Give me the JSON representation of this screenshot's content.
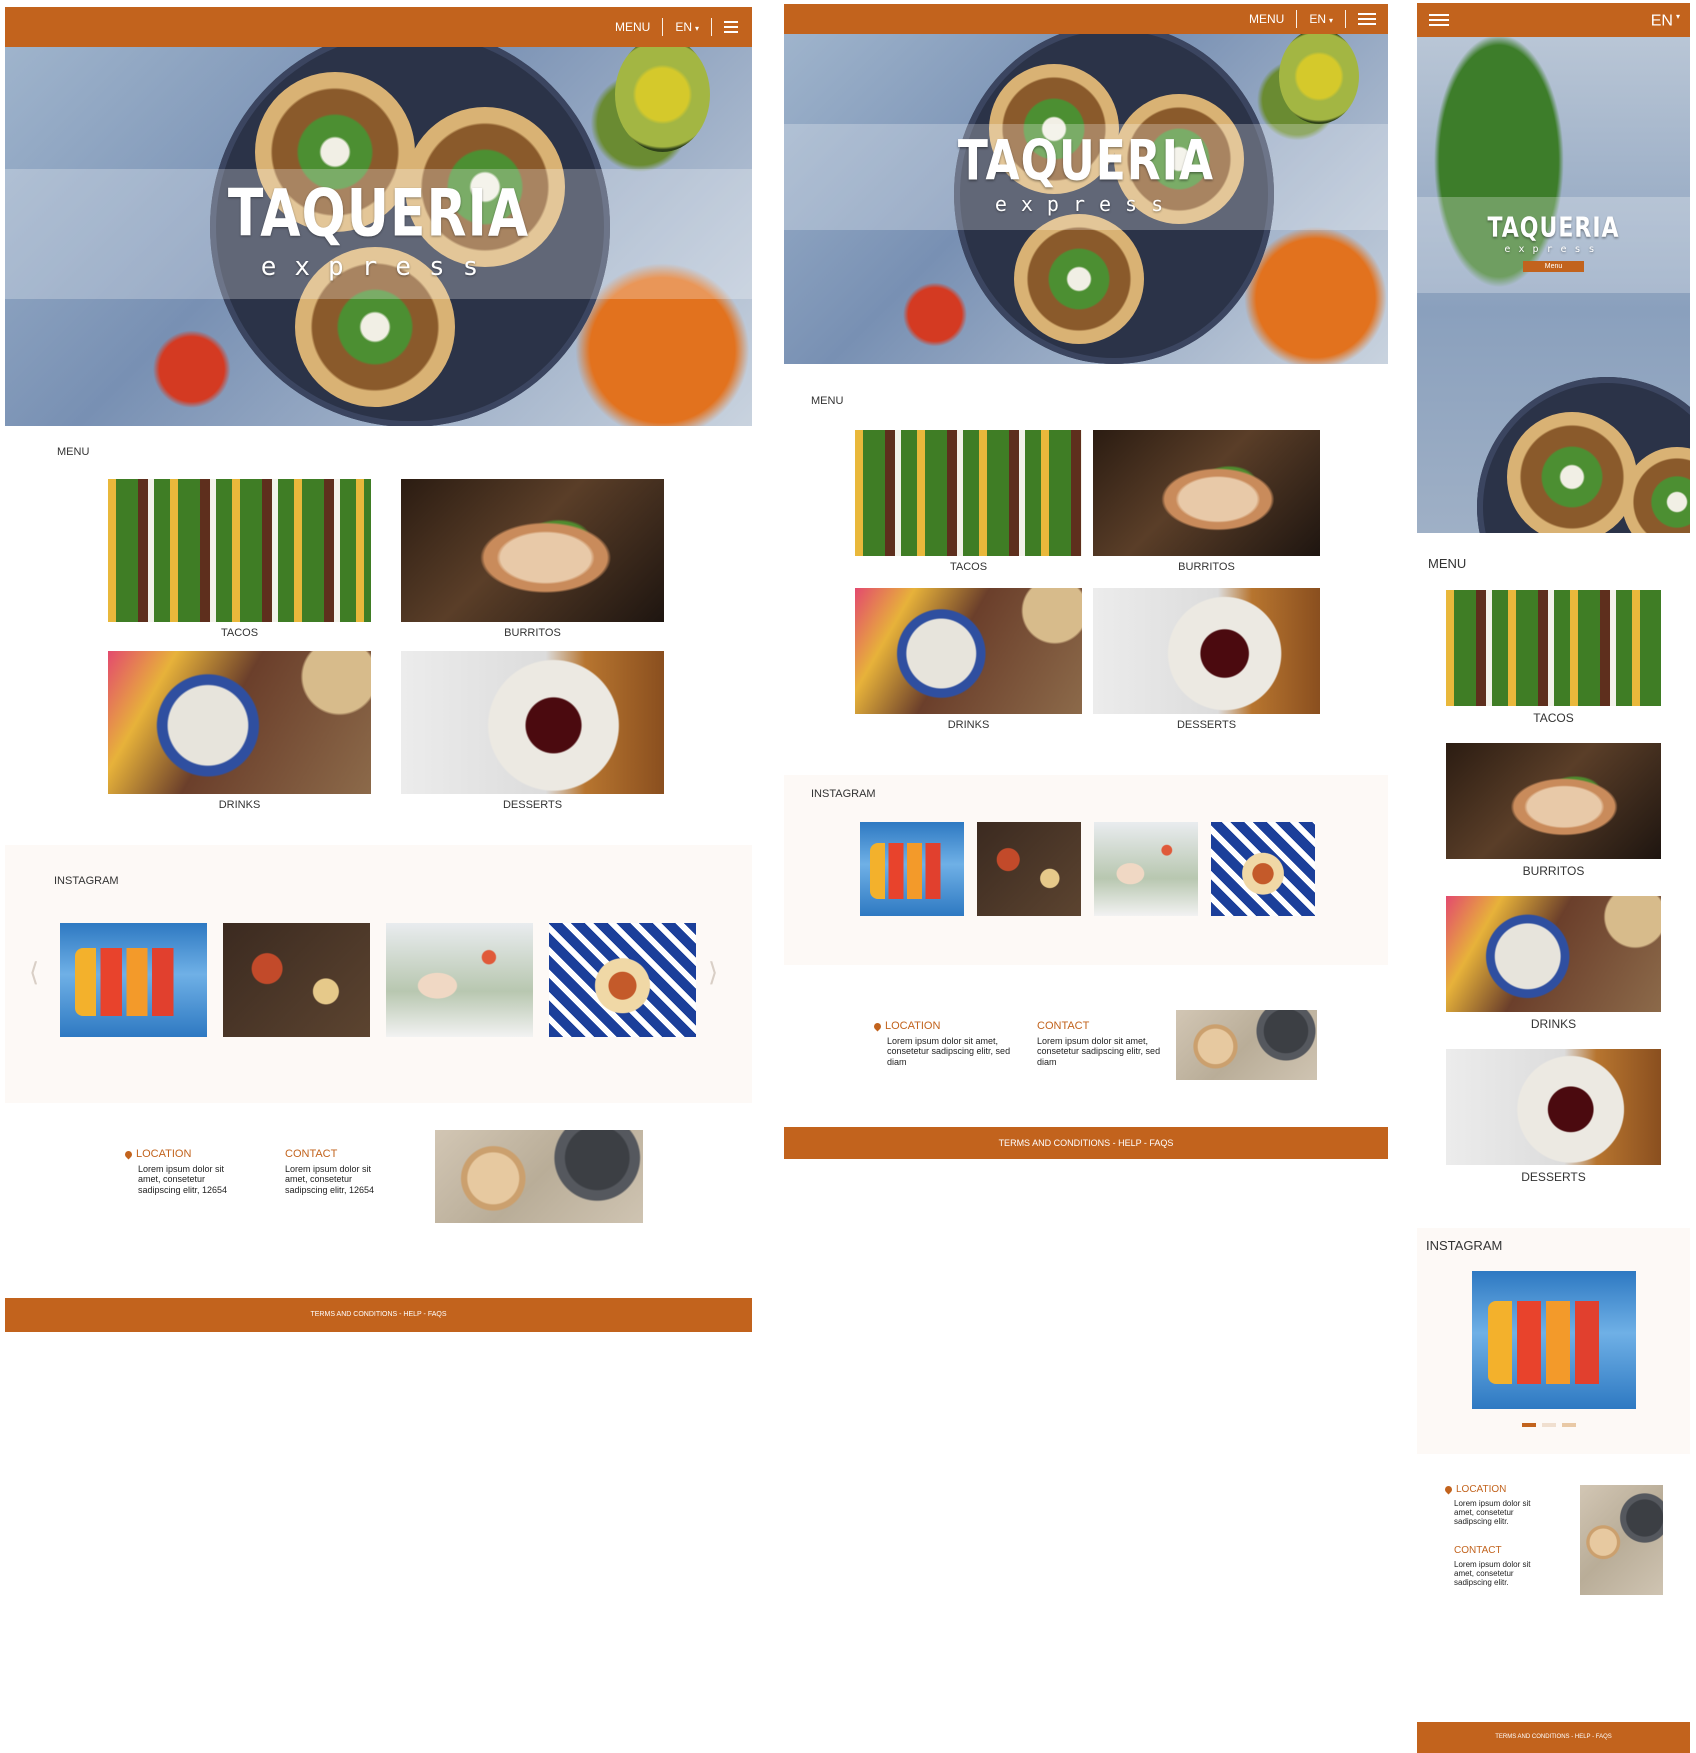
{
  "brand": {
    "title": "TAQUERIA",
    "subtitle": "express",
    "menu_button": "Menu"
  },
  "nav": {
    "menu_label": "MENU",
    "language": "EN"
  },
  "sections": {
    "menu_title": "MENU",
    "instagram_title": "INSTAGRAM"
  },
  "menu_items": [
    {
      "label": "TACOS"
    },
    {
      "label": "BURRITOS"
    },
    {
      "label": "DRINKS"
    },
    {
      "label": "DESSERTS"
    }
  ],
  "instagram": {
    "prev_arrow": "⟨",
    "next_arrow": "⟩",
    "mobile_dots_active": 1,
    "mobile_dots_total": 3
  },
  "location": {
    "heading": "LOCATION",
    "desktop_body": "Lorem ipsum dolor sit amet, consetetur sadipscing elitr, 12654",
    "tablet_body": "Lorem ipsum dolor sit amet, consetetur sadipscing elitr, sed diam",
    "mobile_body": "Lorem ipsum dolor sit amet, consetetur sadipscing elitr."
  },
  "contact": {
    "heading": "CONTACT",
    "desktop_body": "Lorem ipsum dolor sit amet, consetetur sadipscing elitr, 12654",
    "tablet_body": "Lorem ipsum dolor sit amet, consetetur sadipscing elitr, sed diam",
    "mobile_body": "Lorem ipsum dolor sit amet, consetetur sadipscing elitr."
  },
  "footer": {
    "links": "TERMS AND CONDITIONS - HELP - FAQS"
  },
  "colors": {
    "accent": "#c2631d",
    "instagram_bg": "#fdf9f6"
  }
}
